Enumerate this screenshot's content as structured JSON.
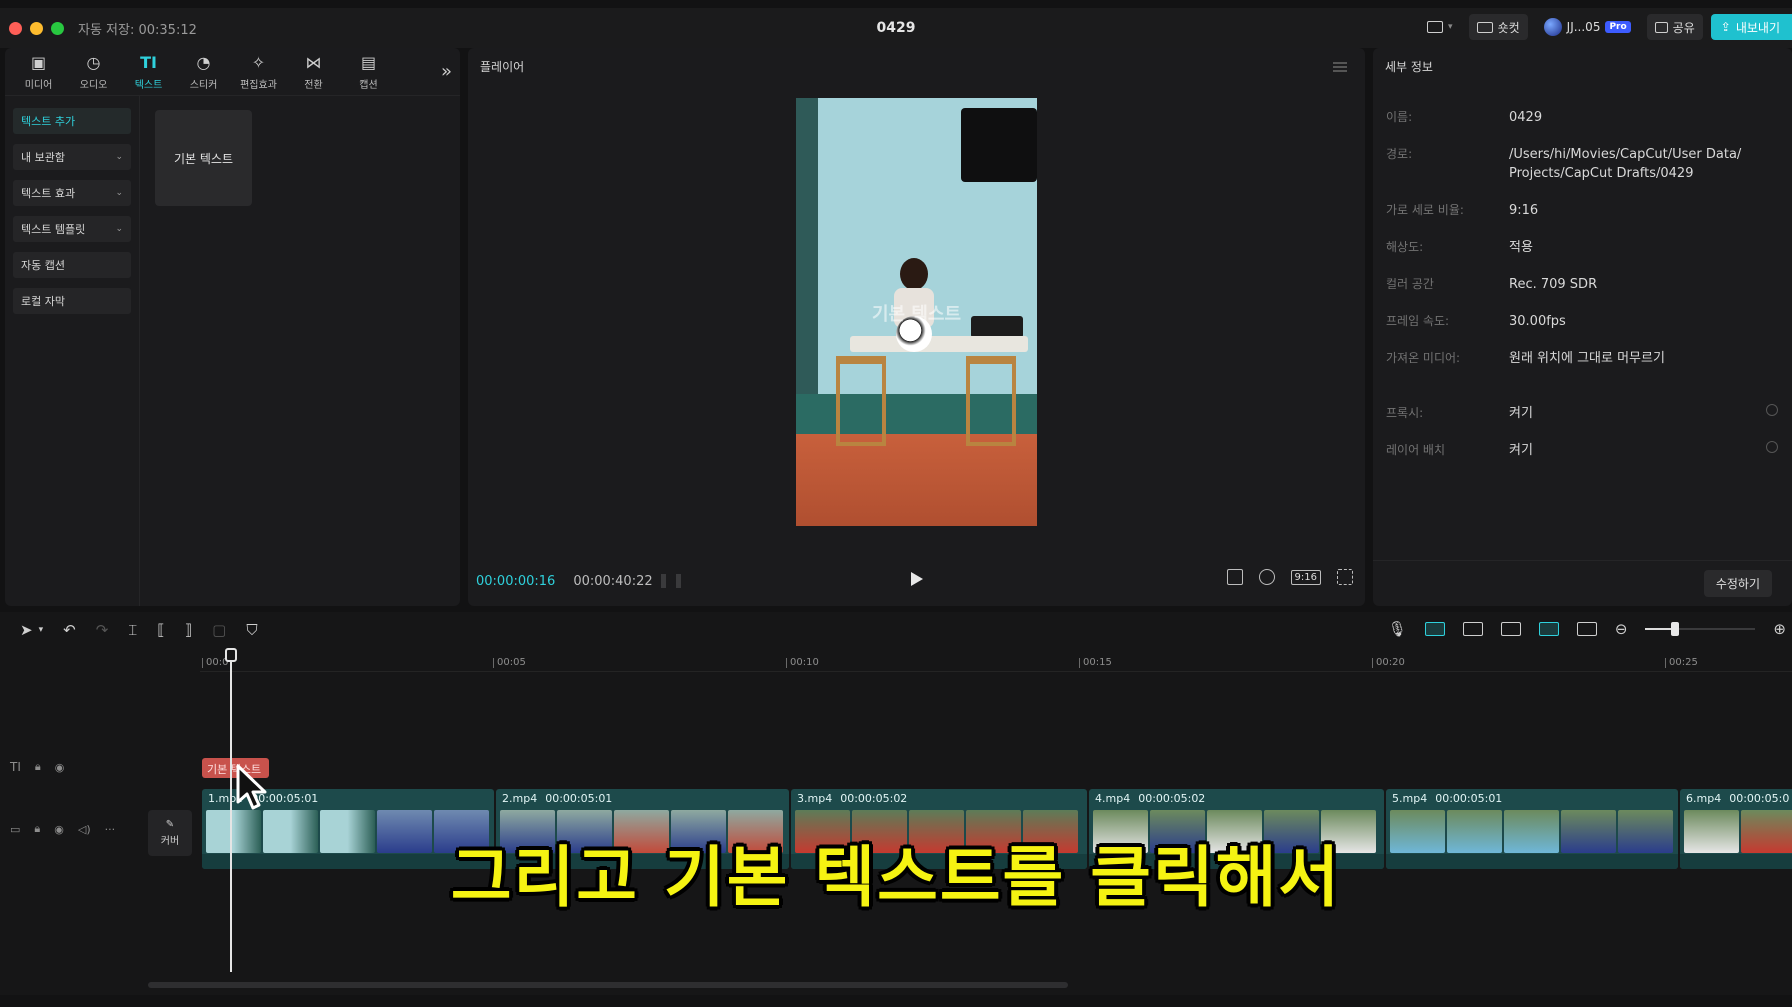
{
  "window": {
    "autosave": "자동 저장: 00:35:12",
    "title": "0429",
    "shortcut_label": "숏컷",
    "user_label": "JJ...05",
    "pro_badge": "Pro",
    "share_label": "공유",
    "export_label": "내보내기"
  },
  "tabs": [
    {
      "label": "미디어",
      "icon": "media-icon"
    },
    {
      "label": "오디오",
      "icon": "audio-icon"
    },
    {
      "label": "텍스트",
      "icon": "text-icon"
    },
    {
      "label": "스티커",
      "icon": "sticker-icon"
    },
    {
      "label": "편집효과",
      "icon": "effects-icon"
    },
    {
      "label": "전환",
      "icon": "transition-icon"
    },
    {
      "label": "캡션",
      "icon": "caption-icon"
    }
  ],
  "side_nav": [
    {
      "label": "텍스트 추가"
    },
    {
      "label": "내 보관함"
    },
    {
      "label": "텍스트 효과"
    },
    {
      "label": "텍스트 템플릿"
    },
    {
      "label": "자동 캡션"
    },
    {
      "label": "로컬 자막"
    }
  ],
  "preset_card": "기본 텍스트",
  "player": {
    "title": "플레이어",
    "overlay_text": "기본 텍스트",
    "current_time": "00:00:00:16",
    "total_time": "00:00:40:22",
    "ratio_label": "9:16"
  },
  "details": {
    "title": "세부 정보",
    "rows": [
      {
        "key": "이름:",
        "value": "0429"
      },
      {
        "key": "경로:",
        "value": "/Users/hi/Movies/CapCut/User Data/ Projects/CapCut Drafts/0429"
      },
      {
        "key": "가로 세로 비율:",
        "value": "9:16"
      },
      {
        "key": "해상도:",
        "value": "적용"
      },
      {
        "key": "컬러 공간",
        "value": "Rec. 709 SDR"
      },
      {
        "key": "프레임 속도:",
        "value": "30.00fps"
      },
      {
        "key": "가져온 미디어:",
        "value": "원래 위치에 그대로 머무르기"
      },
      {
        "key": "프록시:",
        "value": "켜기"
      },
      {
        "key": "레이어 배치",
        "value": "켜기"
      }
    ],
    "edit_button": "수정하기"
  },
  "timeline": {
    "ruler": [
      "00:0",
      "00:05",
      "00:10",
      "00:15",
      "00:20",
      "00:25"
    ],
    "text_clip": "기본 텍스트",
    "cover_label": "커버",
    "clips": [
      {
        "name": "1.mp4",
        "duration": "00:00:05:01"
      },
      {
        "name": "2.mp4",
        "duration": "00:00:05:01"
      },
      {
        "name": "3.mp4",
        "duration": "00:00:05:02"
      },
      {
        "name": "4.mp4",
        "duration": "00:00:05:02"
      },
      {
        "name": "5.mp4",
        "duration": "00:00:05:01"
      },
      {
        "name": "6.mp4",
        "duration": "00:00:05:0"
      }
    ]
  },
  "caption": "그리고 기본 텍스트를 클릭해서",
  "colors": {
    "accent": "#2fd1dc",
    "clip_bg": "#1d4a4b",
    "text_clip": "#c8524c",
    "caption_yellow": "#f5f312"
  }
}
